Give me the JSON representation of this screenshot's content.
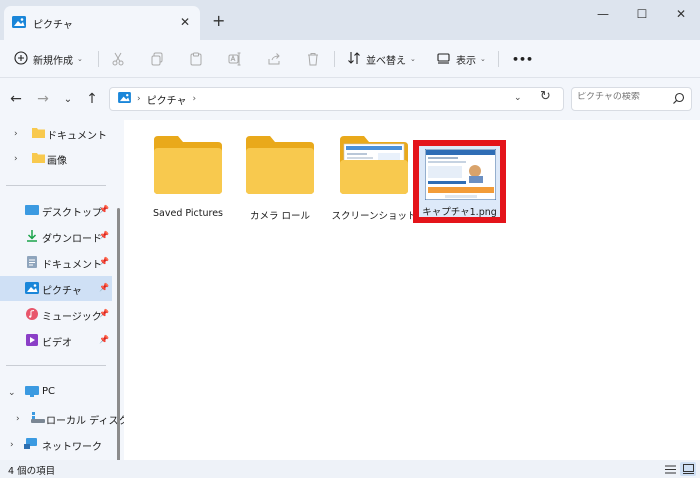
{
  "window": {
    "tab_title": "ピクチャ",
    "tab_icon": "pictures-folder-icon",
    "minimize": "—",
    "maximize": "☐",
    "close": "✕",
    "tab_close": "✕",
    "new_tab": "+"
  },
  "toolbar": {
    "new_label": "新規作成",
    "sort_label": "並べ替え",
    "view_label": "表示",
    "more_label": "•••",
    "caret": "⌄",
    "icons": [
      "cut-icon",
      "copy-icon",
      "paste-icon",
      "rename-icon",
      "share-icon",
      "delete-icon"
    ]
  },
  "address": {
    "back": "←",
    "forward": "→",
    "recent": "⌄",
    "up": "↑",
    "breadcrumb": [
      "ピクチャ"
    ],
    "separator": "›",
    "dropdown": "⌄",
    "refresh": "↻",
    "search_placeholder": "ピクチャの検索"
  },
  "sidebar": {
    "top_items": [
      {
        "label": "ドキュメント",
        "chevron": "›",
        "icon": "folder-icon"
      },
      {
        "label": "画像",
        "chevron": "›",
        "icon": "folder-icon"
      }
    ],
    "quick_access": [
      {
        "label": "デスクトップ",
        "icon": "desktop-icon",
        "pinned": true
      },
      {
        "label": "ダウンロード",
        "icon": "download-icon",
        "pinned": true
      },
      {
        "label": "ドキュメント",
        "icon": "document-icon",
        "pinned": true
      },
      {
        "label": "ピクチャ",
        "icon": "pictures-icon",
        "pinned": true,
        "selected": true
      },
      {
        "label": "ミュージック",
        "icon": "music-icon",
        "pinned": true
      },
      {
        "label": "ビデオ",
        "icon": "video-icon",
        "pinned": true
      }
    ],
    "pin_glyph": "📌",
    "pc": {
      "label": "PC",
      "chevron": "⌄"
    },
    "local_disk": {
      "label": "ローカル ディスク",
      "chevron": "›"
    },
    "network": {
      "label": "ネットワーク",
      "chevron": "›"
    }
  },
  "files": [
    {
      "name": "Saved Pictures",
      "type": "folder"
    },
    {
      "name": "カメラ ロール",
      "type": "folder"
    },
    {
      "name": "スクリーンショット",
      "type": "folder-with-preview"
    },
    {
      "name": "キャプチャ1.png",
      "type": "image",
      "selected": true,
      "highlight_color": "#e4141a"
    }
  ],
  "status": {
    "item_count": "4 個の項目"
  },
  "colors": {
    "accent": "#0067c0",
    "selection": "#cfe0f5",
    "folder": "#f8c94e",
    "highlight": "#e4141a"
  }
}
